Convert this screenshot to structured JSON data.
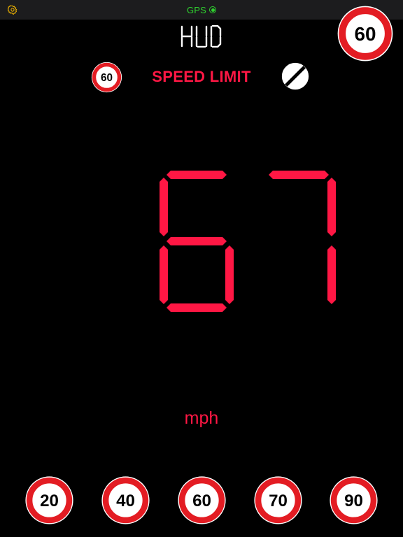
{
  "status_bar": {
    "settings_icon": "gear-icon",
    "gps_label": "GPS",
    "gps_indicator_color": "#2fd12f"
  },
  "header": {
    "hud_label": "HUD",
    "current_limit_badge": "60"
  },
  "limit_row": {
    "small_sign": "60",
    "label": "SPEED LIMIT",
    "end_sign_icon": "end-of-speed-limit-icon"
  },
  "speed": {
    "value": "67",
    "unit": "mph"
  },
  "presets": [
    "20",
    "40",
    "60",
    "70",
    "90"
  ],
  "colors": {
    "background": "#000000",
    "accent": "#ff1744",
    "sign_ring": "#e31c23",
    "sign_fill": "#ffffff",
    "settings_icon": "#f0b400"
  }
}
